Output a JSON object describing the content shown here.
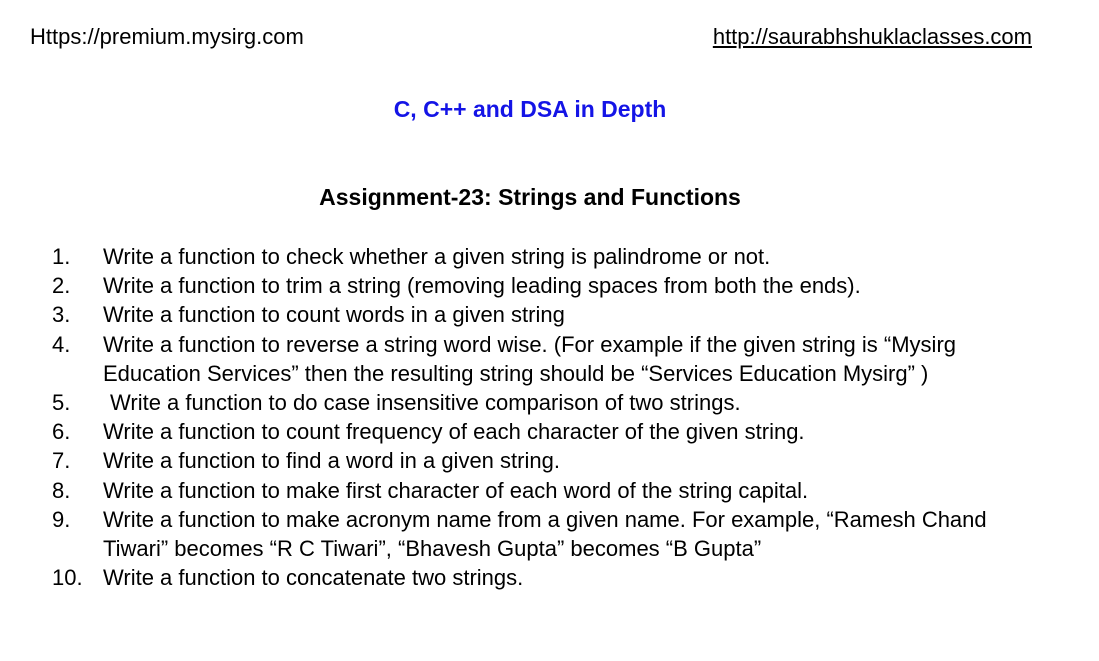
{
  "header": {
    "left_url": "Https://premium.mysirg.com",
    "right_url": "http://saurabhshuklaclasses.com"
  },
  "course_title": "C, C++ and DSA in Depth",
  "assignment_title": "Assignment-23: Strings and Functions",
  "tasks": [
    {
      "number": "1.",
      "text": "Write a function to check whether a given string is palindrome or not."
    },
    {
      "number": "2.",
      "text": "Write a function to trim a string (removing leading spaces from both the ends)."
    },
    {
      "number": "3.",
      "text": "Write a function to count words in a given string"
    },
    {
      "number": "4.",
      "text": "Write a function to reverse a string word wise. (For example if the given string is “Mysirg Education Services” then the resulting string should be “Services Education Mysirg” )"
    },
    {
      "number": "5.",
      "text": "Write a function to do case insensitive comparison of two strings."
    },
    {
      "number": "6.",
      "text": "Write a function to count frequency of each character of the given string."
    },
    {
      "number": "7.",
      "text": "Write a function to find a word in a given string."
    },
    {
      "number": "8.",
      "text": "Write a function to make first character of each word of the string capital."
    },
    {
      "number": "9.",
      "text": "Write a function to make acronym name from a given name. For example, “Ramesh Chand Tiwari” becomes “R C Tiwari”, “Bhavesh Gupta” becomes “B Gupta”"
    },
    {
      "number": "10.",
      "text": "Write a function to concatenate two strings."
    }
  ]
}
